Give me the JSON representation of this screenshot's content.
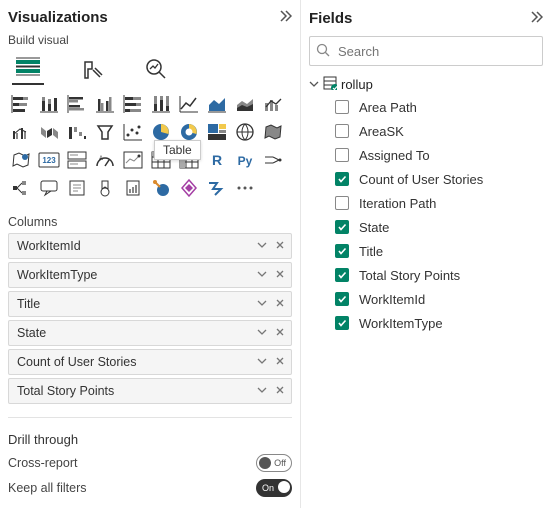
{
  "panes": {
    "viz": {
      "title": "Visualizations",
      "subtitle": "Build visual"
    },
    "fields": {
      "title": "Fields"
    }
  },
  "search": {
    "placeholder": "Search"
  },
  "tooltip": "Table",
  "columnsLabel": "Columns",
  "columns": [
    "WorkItemId",
    "WorkItemType",
    "Title",
    "State",
    "Count of User Stories",
    "Total Story Points"
  ],
  "drill": {
    "title": "Drill through",
    "crossLabel": "Cross-report",
    "crossState": "Off",
    "keepLabel": "Keep all filters",
    "keepState": "On"
  },
  "tree": {
    "root": "rollup"
  },
  "fields": [
    {
      "label": "Area Path",
      "checked": false
    },
    {
      "label": "AreaSK",
      "checked": false
    },
    {
      "label": "Assigned To",
      "checked": false
    },
    {
      "label": "Count of User Stories",
      "checked": true
    },
    {
      "label": "Iteration Path",
      "checked": false
    },
    {
      "label": "State",
      "checked": true
    },
    {
      "label": "Title",
      "checked": true
    },
    {
      "label": "Total Story Points",
      "checked": true
    },
    {
      "label": "WorkItemId",
      "checked": true
    },
    {
      "label": "WorkItemType",
      "checked": true
    }
  ]
}
